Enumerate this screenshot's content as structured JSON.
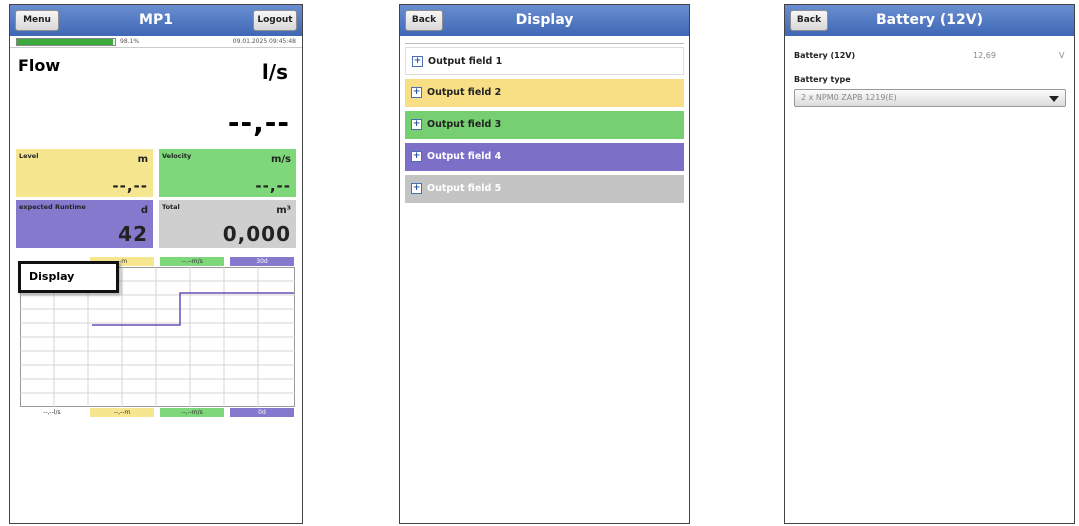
{
  "screen1": {
    "title": "MP1",
    "menu_label": "Menu",
    "logout_label": "Logout",
    "progress_percent": 98.1,
    "progress_text": "98.1%",
    "timestamp": "09.01.2025 09:45:48",
    "flow": {
      "label": "Flow",
      "unit": "l/s",
      "value": "--,--"
    },
    "tiles": [
      {
        "label": "Level",
        "unit": "m",
        "value": "--,--",
        "color": "#f5e68f"
      },
      {
        "label": "Velocity",
        "unit": "m/s",
        "value": "--,--",
        "color": "#7ed87a"
      },
      {
        "label": "expected Runtime",
        "unit": "d",
        "value": "42",
        "color": "#8479cc"
      },
      {
        "label": "Total",
        "unit": "m³",
        "value": "0,000",
        "color": "#cfcfcf"
      }
    ],
    "chart_top_labels": [
      "--m",
      "--.--m/s",
      "30d"
    ],
    "chart_bottom_labels": [
      "--,--l/s",
      "--,--m",
      "--,--m/s",
      "0d"
    ],
    "popup_label": "Display"
  },
  "screen2": {
    "title": "Display",
    "back_label": "Back",
    "items": [
      {
        "label": "Output field 1",
        "color": "#ffffff"
      },
      {
        "label": "Output field 2",
        "color": "#f8df86"
      },
      {
        "label": "Output field 3",
        "color": "#76d071"
      },
      {
        "label": "Output field 4",
        "color": "#7b6fc8"
      },
      {
        "label": "Output field 5",
        "color": "#c4c4c4"
      }
    ]
  },
  "screen3": {
    "title": "Battery (12V)",
    "back_label": "Back",
    "battery_label": "Battery (12V)",
    "battery_value": "12,69",
    "battery_unit": "V",
    "type_label": "Battery type",
    "type_value": "2 x NPM0 ZAPB 1219(E)"
  }
}
